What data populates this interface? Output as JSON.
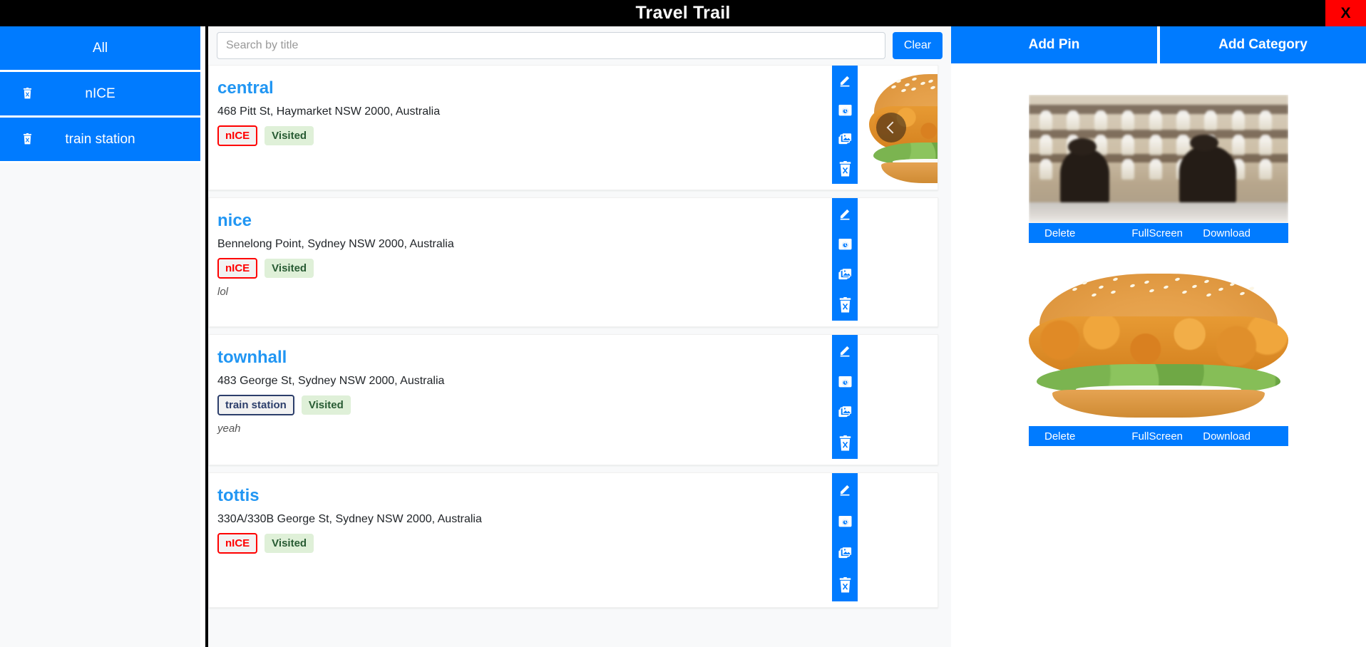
{
  "window": {
    "title": "Travel Trail",
    "close_label": "X"
  },
  "sidebar": {
    "items": [
      {
        "label": "All",
        "deletable": false,
        "delete_icon": "trash-icon"
      },
      {
        "label": "nICE",
        "deletable": true,
        "delete_icon": "trash-icon"
      },
      {
        "label": "train station",
        "deletable": true,
        "delete_icon": "trash-icon"
      }
    ]
  },
  "search": {
    "placeholder": "Search by title",
    "value": "",
    "clear_label": "Clear"
  },
  "pins": [
    {
      "title": "central",
      "address": "468 Pitt St, Haymarket NSW 2000, Australia",
      "category": "nICE",
      "category_style": "red",
      "visited_label": "Visited",
      "note": "",
      "photo": "burger",
      "has_carousel_prev": true
    },
    {
      "title": "nice",
      "address": "Bennelong Point, Sydney NSW 2000, Australia",
      "category": "nICE",
      "category_style": "red",
      "visited_label": "Visited",
      "note": "lol",
      "photo": "none",
      "has_carousel_prev": false
    },
    {
      "title": "townhall",
      "address": "483 George St, Sydney NSW 2000, Australia",
      "category": "train station",
      "category_style": "navy",
      "visited_label": "Visited",
      "note": "yeah",
      "photo": "none",
      "has_carousel_prev": false
    },
    {
      "title": "tottis",
      "address": "330A/330B George St, Sydney NSW 2000, Australia",
      "category": "nICE",
      "category_style": "red",
      "visited_label": "Visited",
      "note": "",
      "photo": "none",
      "has_carousel_prev": false
    }
  ],
  "pin_actions": [
    {
      "name": "edit-icon",
      "tooltip": "Edit"
    },
    {
      "name": "camera-icon",
      "tooltip": "Take photo"
    },
    {
      "name": "gallery-icon",
      "tooltip": "Photos"
    },
    {
      "name": "trash-icon",
      "tooltip": "Delete"
    }
  ],
  "right_panel": {
    "tabs": [
      {
        "label": "Add Pin"
      },
      {
        "label": "Add Category"
      }
    ],
    "gallery": [
      {
        "image": "bar-scene",
        "actions": [
          "Delete",
          "FullScreen",
          "Download"
        ]
      },
      {
        "image": "burger",
        "actions": [
          "Delete",
          "FullScreen",
          "Download"
        ]
      }
    ]
  },
  "colors": {
    "accent": "#007bff",
    "title_link": "#2196f3",
    "danger": "#ff0000",
    "visited_bg": "#dff0d8",
    "visited_text": "#285b33",
    "navy": "#2c3e6b",
    "titlebar_bg": "#000000",
    "panel_bg": "#f8f9fa"
  },
  "scrollbar": {
    "up_icon": "caret-up-icon",
    "down_icon": "caret-down-icon"
  }
}
